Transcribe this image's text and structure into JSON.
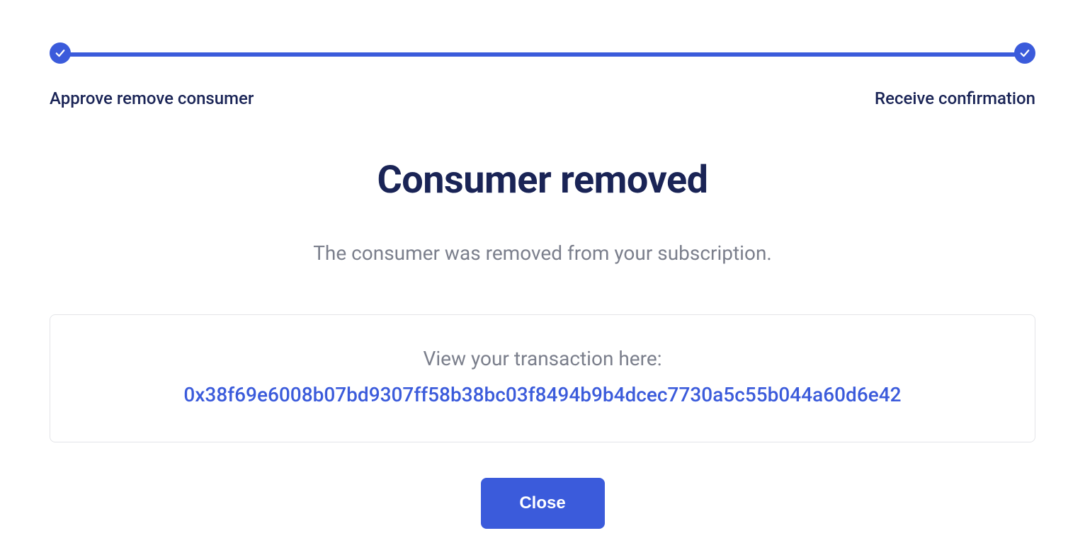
{
  "stepper": {
    "steps": [
      {
        "label": "Approve remove consumer"
      },
      {
        "label": "Receive confirmation"
      }
    ]
  },
  "main": {
    "heading": "Consumer removed",
    "subtext": "The consumer was removed from your subscription."
  },
  "transaction": {
    "label": "View your transaction here:",
    "hash": "0x38f69e6008b07bd9307ff58b38bc03f8494b9b4dcec7730a5c55b044a60d6e42"
  },
  "actions": {
    "close_label": "Close"
  },
  "colors": {
    "accent": "#3b5bdb",
    "heading": "#1a2456",
    "muted": "#7b7f8c",
    "border": "#e3e4e8"
  }
}
